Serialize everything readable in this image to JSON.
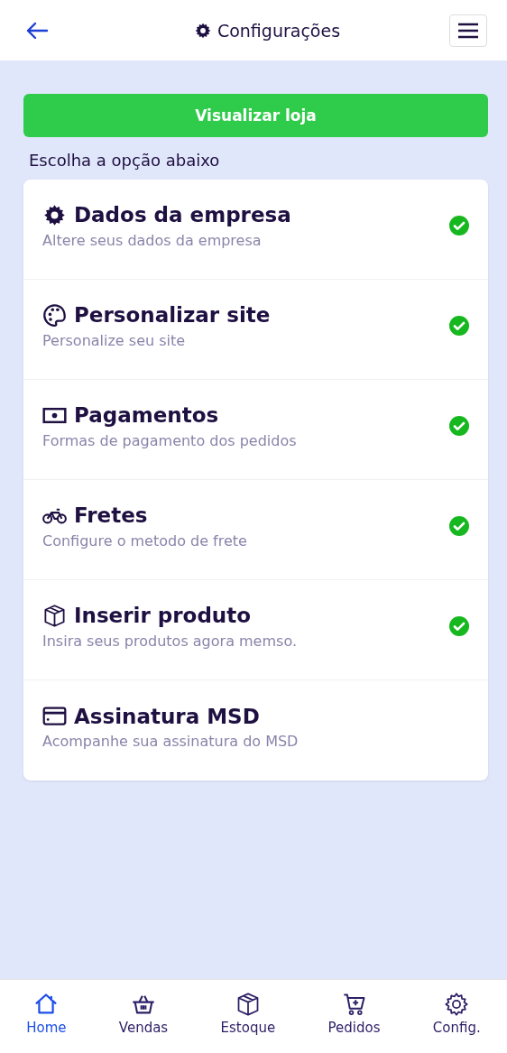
{
  "header": {
    "title": "Configurações"
  },
  "view_store_button": "Visualizar loja",
  "section_label": "Escolha a opção abaixo",
  "options": [
    {
      "title": "Dados da empresa",
      "subtitle": "Altere seus dados da empresa",
      "done": true
    },
    {
      "title": "Personalizar site",
      "subtitle": "Personalize seu site",
      "done": true
    },
    {
      "title": "Pagamentos",
      "subtitle": "Formas de pagamento dos pedidos",
      "done": true
    },
    {
      "title": "Fretes",
      "subtitle": "Configure o metodo de frete",
      "done": true
    },
    {
      "title": "Inserir produto",
      "subtitle": "Insira seus produtos agora memso.",
      "done": true
    },
    {
      "title": "Assinatura MSD",
      "subtitle": "Acompanhe sua assinatura do MSD",
      "done": false
    }
  ],
  "bottom_nav": [
    {
      "label": "Home",
      "selected": true
    },
    {
      "label": "Vendas",
      "selected": false
    },
    {
      "label": "Estoque",
      "selected": false
    },
    {
      "label": "Pedidos",
      "selected": false
    },
    {
      "label": "Config.",
      "selected": false
    }
  ]
}
